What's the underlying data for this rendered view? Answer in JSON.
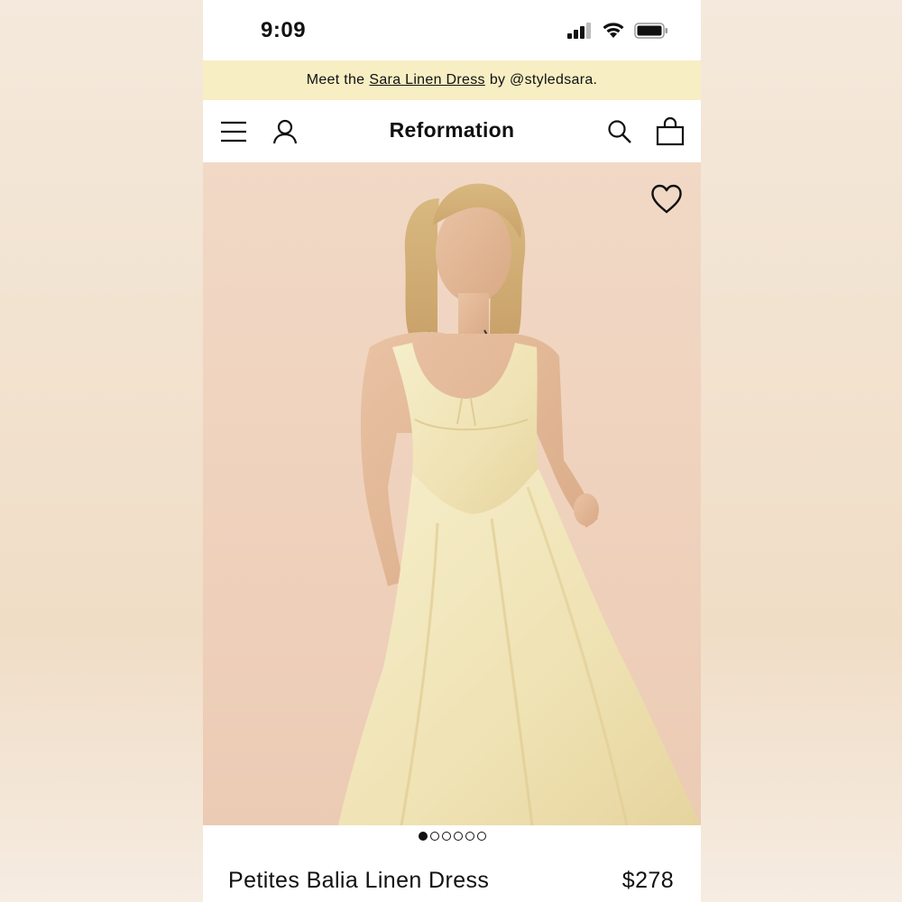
{
  "status_bar": {
    "time": "9:09"
  },
  "promo": {
    "prefix": "Meet the",
    "link": "Sara Linen Dress",
    "suffix": "by @styledsara."
  },
  "nav": {
    "brand": "Reformation",
    "icons": [
      "menu-icon",
      "account-icon",
      "search-icon",
      "bag-icon"
    ]
  },
  "product": {
    "name": "Petites Balia Linen Dress",
    "price": "$278",
    "image_count": 6,
    "active_image_index": 0
  },
  "colors": {
    "promo_bg": "#f7eec3",
    "hero_bg": "#efd2bd",
    "dress": "#f3e7bd"
  }
}
